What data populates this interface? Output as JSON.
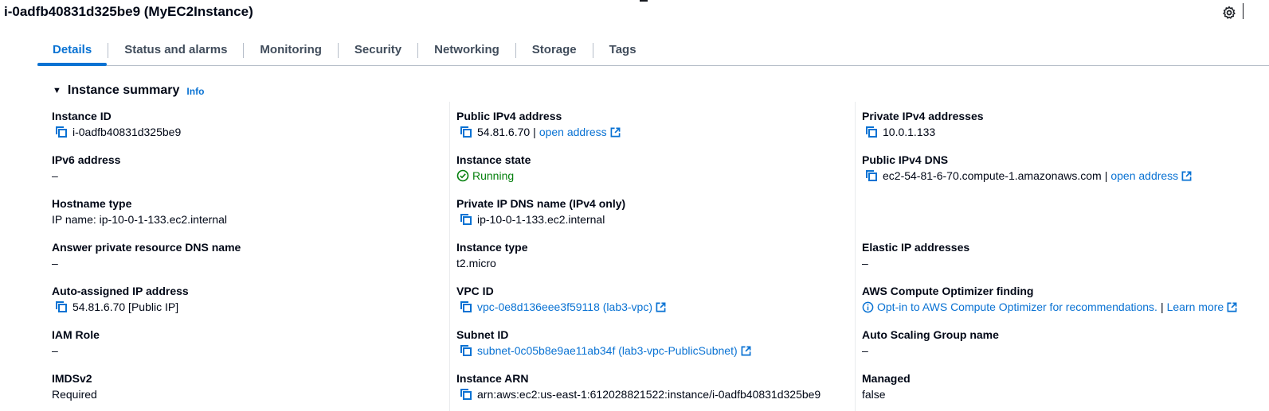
{
  "header": {
    "title": "i-0adfb40831d325be9 (MyEC2Instance)"
  },
  "tabs": [
    {
      "label": "Details",
      "active": true
    },
    {
      "label": "Status and alarms"
    },
    {
      "label": "Monitoring"
    },
    {
      "label": "Security"
    },
    {
      "label": "Networking"
    },
    {
      "label": "Storage"
    },
    {
      "label": "Tags"
    }
  ],
  "summary": {
    "title": "Instance summary",
    "info": "Info"
  },
  "col1": {
    "instance_id": {
      "label": "Instance ID",
      "value": "i-0adfb40831d325be9"
    },
    "ipv6": {
      "label": "IPv6 address",
      "value": "–"
    },
    "hostname_type": {
      "label": "Hostname type",
      "value": "IP name: ip-10-0-1-133.ec2.internal"
    },
    "answer_dns": {
      "label": "Answer private resource DNS name",
      "value": "–"
    },
    "auto_ip": {
      "label": "Auto-assigned IP address",
      "value": "54.81.6.70 [Public IP]"
    },
    "iam_role": {
      "label": "IAM Role",
      "value": "–"
    },
    "imdsv2": {
      "label": "IMDSv2",
      "value": "Required"
    }
  },
  "col2": {
    "public_ipv4": {
      "label": "Public IPv4 address",
      "value": "54.81.6.70",
      "link": "open address"
    },
    "state": {
      "label": "Instance state",
      "value": "Running"
    },
    "private_dns": {
      "label": "Private IP DNS name (IPv4 only)",
      "value": "ip-10-0-1-133.ec2.internal"
    },
    "instance_type": {
      "label": "Instance type",
      "value": "t2.micro"
    },
    "vpc": {
      "label": "VPC ID",
      "value": "vpc-0e8d136eee3f59118 (lab3-vpc)"
    },
    "subnet": {
      "label": "Subnet ID",
      "value": "subnet-0c05b8e9ae11ab34f (lab3-vpc-PublicSubnet)"
    },
    "arn": {
      "label": "Instance ARN",
      "value": "arn:aws:ec2:us-east-1:612028821522:instance/i-0adfb40831d325be9"
    }
  },
  "col3": {
    "private_ipv4": {
      "label": "Private IPv4 addresses",
      "value": "10.0.1.133"
    },
    "public_dns": {
      "label": "Public IPv4 DNS",
      "value": "ec2-54-81-6-70.compute-1.amazonaws.com",
      "link": "open address"
    },
    "elastic_ip": {
      "label": "Elastic IP addresses",
      "value": "–"
    },
    "optimizer": {
      "label": "AWS Compute Optimizer finding",
      "value": "Opt-in to AWS Compute Optimizer for recommendations.",
      "link": "Learn more"
    },
    "asg": {
      "label": "Auto Scaling Group name",
      "value": "–"
    },
    "managed": {
      "label": "Managed",
      "value": "false"
    }
  },
  "colors": {
    "accent": "#0972d3",
    "success": "#037f0c",
    "text": "#000716"
  }
}
